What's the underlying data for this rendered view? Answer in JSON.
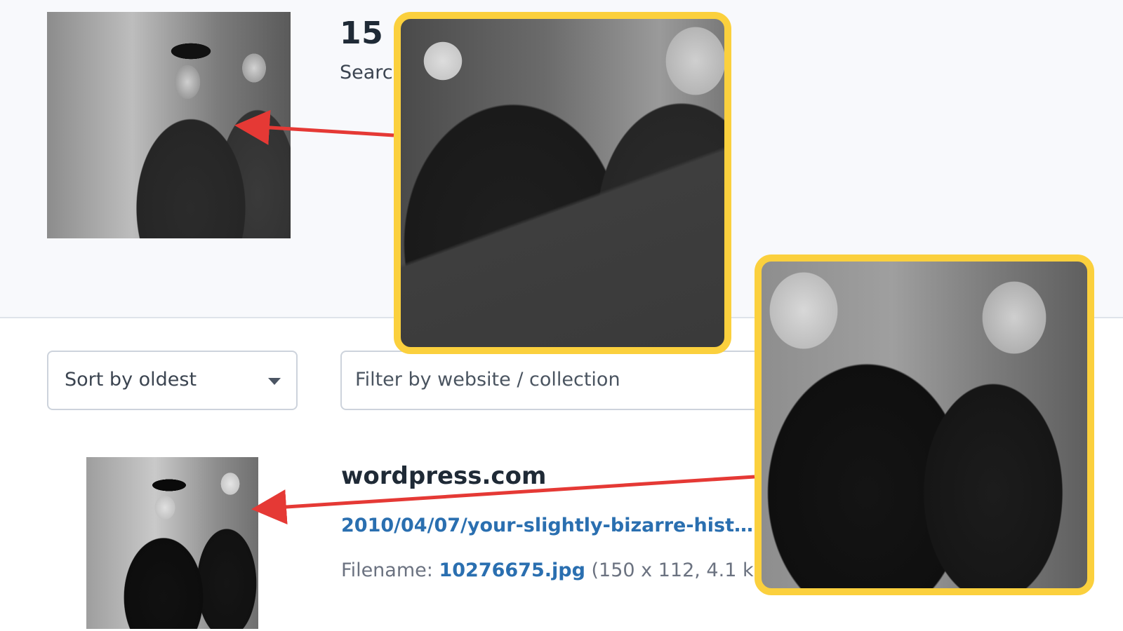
{
  "header": {
    "results_count": "15 r",
    "results_sub": "Searc                                                  econds"
  },
  "controls": {
    "sort_label": "Sort by oldest",
    "filter_placeholder": "Filter by website / collection"
  },
  "result": {
    "site": "wordpress.com",
    "link": "2010/04/07/your-slightly-bizarre-histor...",
    "filename_label": "Filename:",
    "filename": "10276675.jpg",
    "file_meta": "(150 x 112, 4.1 kB)"
  },
  "icons": {
    "sort_caret": "caret-down-icon"
  },
  "colors": {
    "highlight_border": "#fbd03d",
    "arrow": "#e53935",
    "link": "#2a6fb0"
  }
}
